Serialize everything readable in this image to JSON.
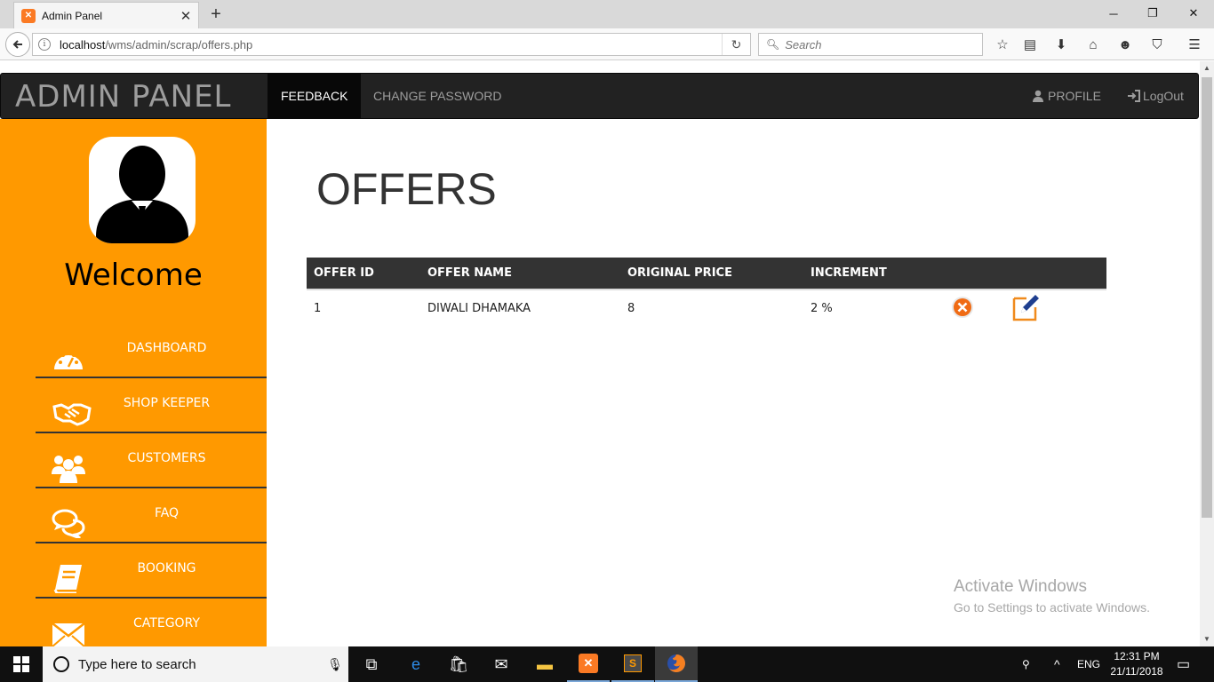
{
  "browser": {
    "tab_title": "Admin Panel",
    "tab_close": "✕",
    "new_tab": "+",
    "url_host": "localhost",
    "url_path": "/wms/admin/scrap/offers.php",
    "search_placeholder": "Search",
    "window_controls": [
      "─",
      "❐",
      "✕"
    ]
  },
  "topnav": {
    "brand": "ADMIN PANEL",
    "links": [
      {
        "label": "FEEDBACK",
        "active": true
      },
      {
        "label": "CHANGE PASSWORD",
        "active": false
      }
    ],
    "profile": "PROFILE",
    "logout": "LogOut"
  },
  "sidebar": {
    "welcome": "Welcome",
    "items": [
      {
        "label": "DASHBOARD",
        "icon": "dashboard-icon"
      },
      {
        "label": "SHOP KEEPER",
        "icon": "handshake-icon"
      },
      {
        "label": "CUSTOMERS",
        "icon": "users-icon"
      },
      {
        "label": "FAQ",
        "icon": "chat-icon"
      },
      {
        "label": "BOOKING",
        "icon": "book-icon"
      },
      {
        "label": "CATEGORY",
        "icon": "envelope-icon"
      }
    ]
  },
  "main": {
    "title": "OFFERS",
    "table": {
      "headers": [
        "OFFER ID",
        "OFFER NAME",
        "ORIGINAL PRICE",
        "INCREMENT"
      ],
      "rows": [
        {
          "id": "1",
          "name": "DIWALI DHAMAKA",
          "price": "8",
          "increment": "2 %"
        }
      ]
    }
  },
  "watermark": {
    "line1": "Activate Windows",
    "line2": "Go to Settings to activate Windows."
  },
  "taskbar": {
    "search_placeholder": "Type here to search",
    "lang": "ENG",
    "time": "12:31 PM",
    "date": "21/11/2018"
  },
  "colors": {
    "sidebar": "#ff9900",
    "navbar": "#222222",
    "table_header": "#333333"
  }
}
